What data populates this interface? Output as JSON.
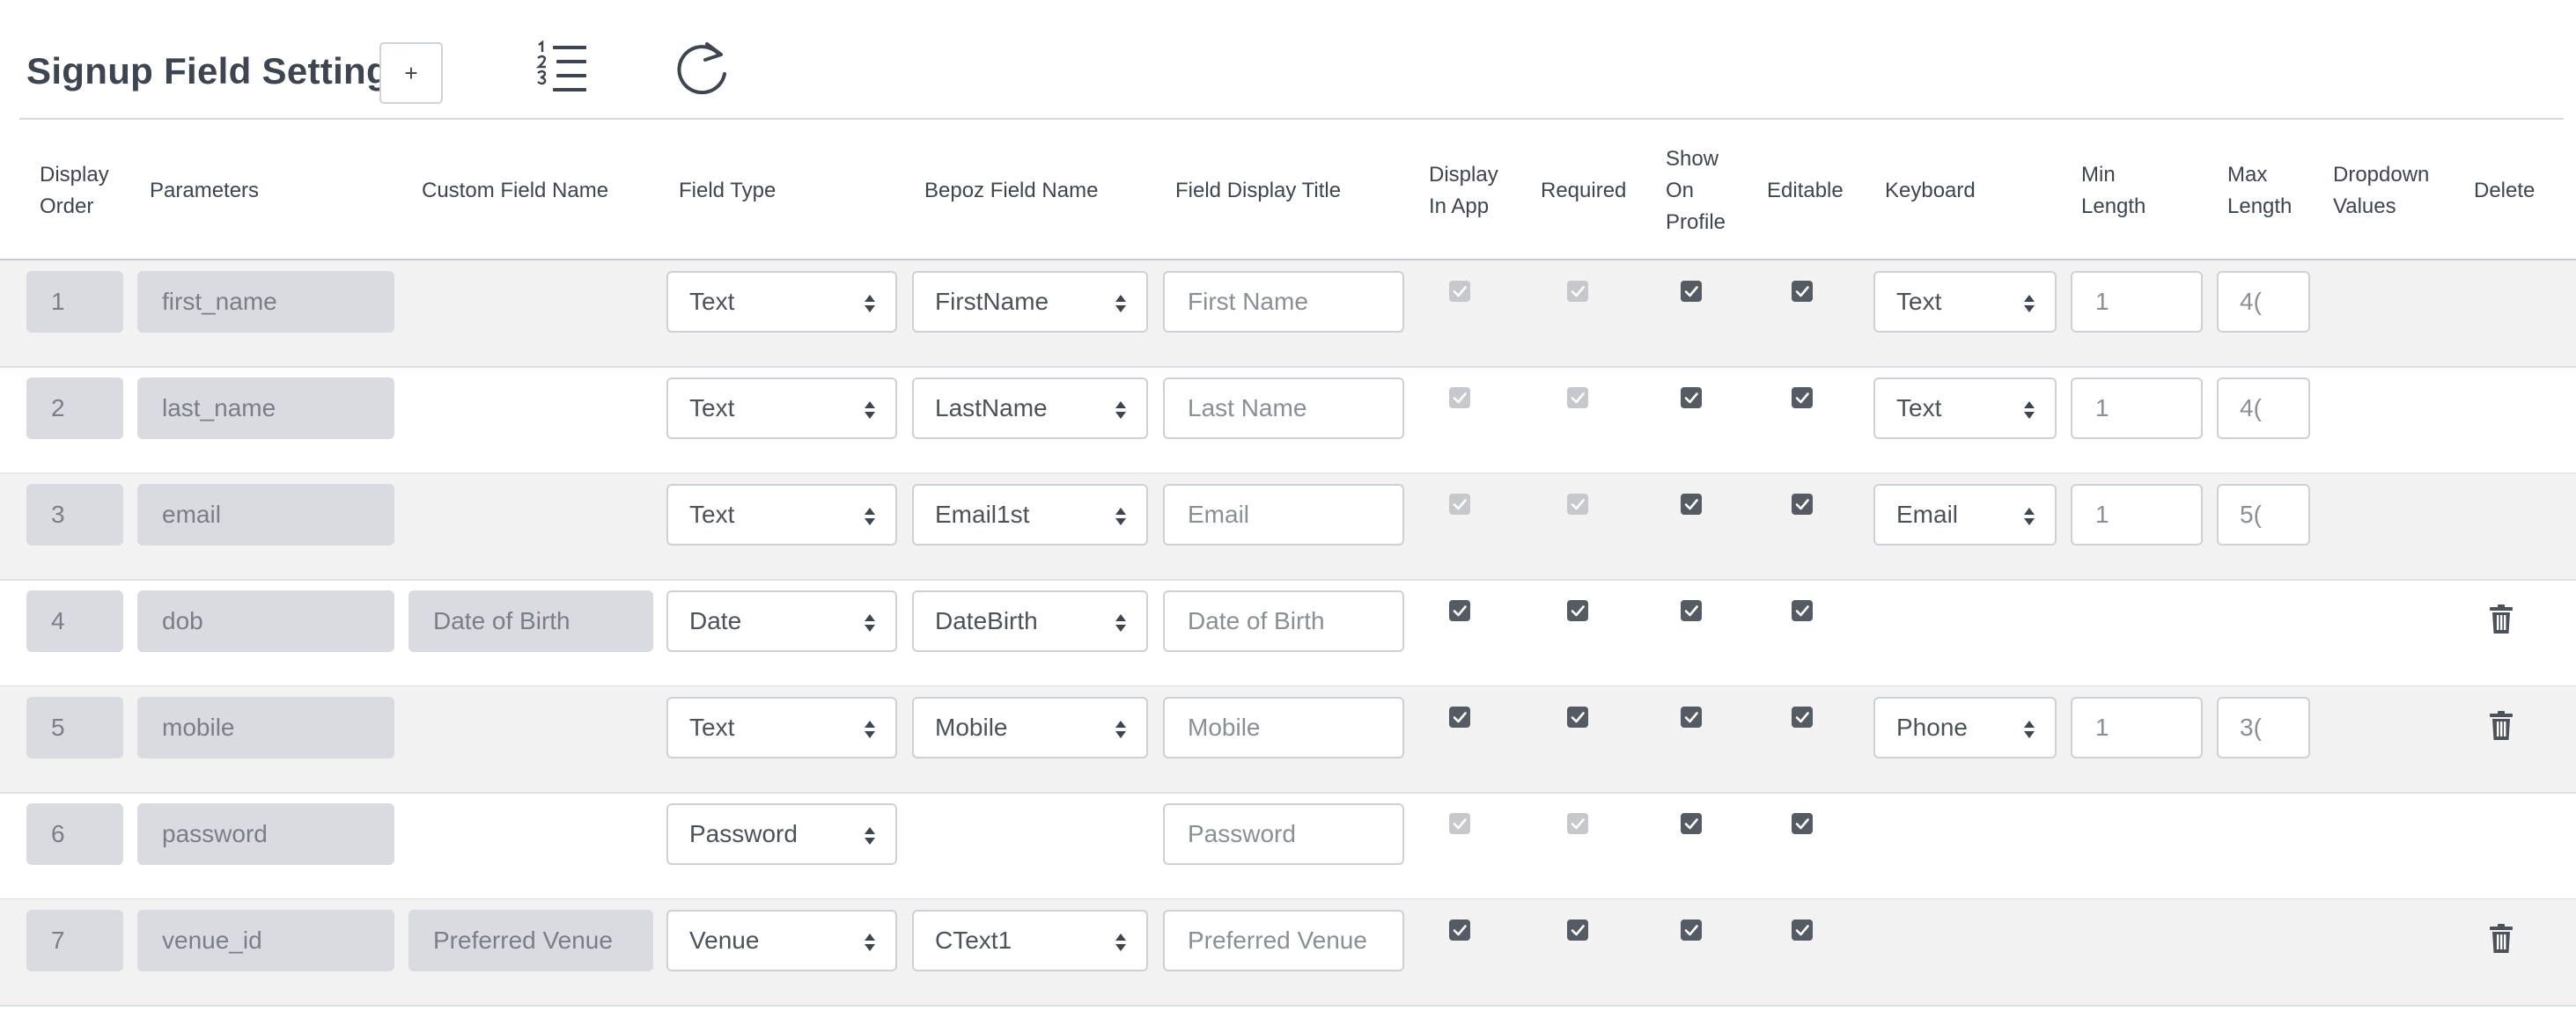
{
  "header": {
    "title": "Signup Field Setting",
    "add_label": "+",
    "order_icon": "ordered-list-icon",
    "refresh_icon": "refresh-icon"
  },
  "columns": {
    "display_order": [
      "Display",
      "Order"
    ],
    "parameters": "Parameters",
    "custom_field_name": "Custom Field Name",
    "field_type": "Field Type",
    "bepoz_field_name": "Bepoz Field Name",
    "field_display_title": "Field Display Title",
    "display_in_app": [
      "Display",
      "In App"
    ],
    "required": "Required",
    "show_on_profile": [
      "Show",
      "On",
      "Profile"
    ],
    "editable": "Editable",
    "keyboard": "Keyboard",
    "min_length": [
      "Min",
      "Length"
    ],
    "max_length": [
      "Max",
      "Length"
    ],
    "dropdown_values": [
      "Dropdown",
      "Values"
    ],
    "delete": "Delete"
  },
  "rows": [
    {
      "order": "1",
      "param": "first_name",
      "custom": "",
      "type": "Text",
      "bepoz": "FirstName",
      "title": "First Name",
      "display_in_app": "disabled",
      "required": "disabled",
      "show_on_profile": "checked",
      "editable": "checked",
      "keyboard": "Text",
      "min": "1",
      "max": "4(",
      "deletable": false
    },
    {
      "order": "2",
      "param": "last_name",
      "custom": "",
      "type": "Text",
      "bepoz": "LastName",
      "title": "Last Name",
      "display_in_app": "disabled",
      "required": "disabled",
      "show_on_profile": "checked",
      "editable": "checked",
      "keyboard": "Text",
      "min": "1",
      "max": "4(",
      "deletable": false
    },
    {
      "order": "3",
      "param": "email",
      "custom": "",
      "type": "Text",
      "bepoz": "Email1st",
      "title": "Email",
      "display_in_app": "disabled",
      "required": "disabled",
      "show_on_profile": "checked",
      "editable": "checked",
      "keyboard": "Email",
      "min": "1",
      "max": "5(",
      "deletable": false
    },
    {
      "order": "4",
      "param": "dob",
      "custom": "Date of Birth",
      "type": "Date",
      "bepoz": "DateBirth",
      "title": "Date of Birth",
      "display_in_app": "checked",
      "required": "checked",
      "show_on_profile": "checked",
      "editable": "checked",
      "keyboard": "",
      "min": "",
      "max": "",
      "deletable": true
    },
    {
      "order": "5",
      "param": "mobile",
      "custom": "",
      "type": "Text",
      "bepoz": "Mobile",
      "title": "Mobile",
      "display_in_app": "checked",
      "required": "checked",
      "show_on_profile": "checked",
      "editable": "checked",
      "keyboard": "Phone",
      "min": "1",
      "max": "3(",
      "deletable": true
    },
    {
      "order": "6",
      "param": "password",
      "custom": "",
      "type": "Password",
      "bepoz": "",
      "title": "Password",
      "display_in_app": "disabled",
      "required": "disabled",
      "show_on_profile": "checked",
      "editable": "checked",
      "keyboard": "",
      "min": "",
      "max": "",
      "deletable": false
    },
    {
      "order": "7",
      "param": "venue_id",
      "custom": "Preferred Venue",
      "type": "Venue",
      "bepoz": "CText1",
      "title": "Preferred Venue",
      "display_in_app": "checked",
      "required": "checked",
      "show_on_profile": "checked",
      "editable": "checked",
      "keyboard": "",
      "min": "",
      "max": "",
      "deletable": true
    }
  ],
  "colors": {
    "checkbox_checked": "#555b62",
    "checkbox_disabled": "#c6c8cb",
    "readonly_field": "#d9dbe0",
    "row_alt": "#f2f2f2"
  }
}
